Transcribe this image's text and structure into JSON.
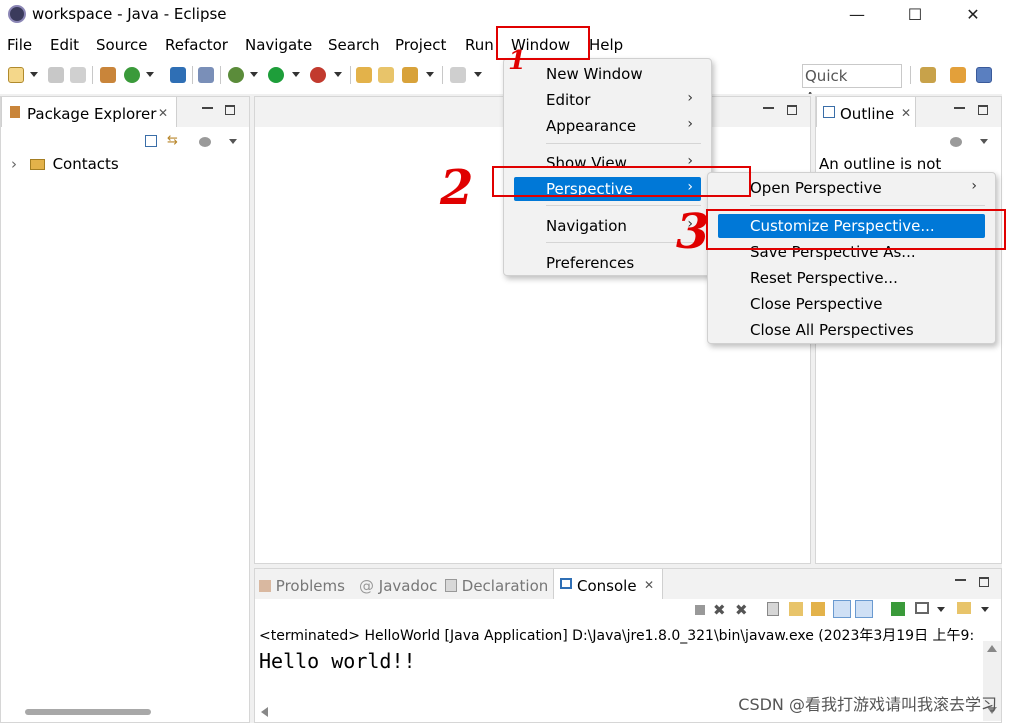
{
  "window": {
    "title": "workspace - Java - Eclipse",
    "minimize": "—",
    "maximize": "☐",
    "close": "✕"
  },
  "menubar": {
    "items": [
      "File",
      "Edit",
      "Source",
      "Refactor",
      "Navigate",
      "Search",
      "Project",
      "Run",
      "Window",
      "Help"
    ]
  },
  "toolbar": {
    "quick_access": "Quick Access"
  },
  "package_explorer": {
    "tab": "Package Explorer",
    "tree": [
      {
        "label": "Contacts",
        "expand": "›"
      }
    ]
  },
  "outline": {
    "tab": "Outline",
    "message": "An outline is not"
  },
  "bottom_tabs": [
    "Problems",
    "Javadoc",
    "Declaration",
    "Console"
  ],
  "console": {
    "status": "<terminated> HelloWorld [Java Application] D:\\Java\\jre1.8.0_321\\bin\\javaw.exe (2023年3月19日 上午9:",
    "output": "Hello world!!"
  },
  "window_menu": {
    "items": [
      {
        "label": "New Window",
        "submenu": false
      },
      {
        "label": "Editor",
        "submenu": true
      },
      {
        "label": "Appearance",
        "submenu": true
      },
      {
        "label": "Show View",
        "submenu": true
      },
      {
        "label": "Perspective",
        "submenu": true,
        "highlighted": true
      },
      {
        "label": "Navigation",
        "submenu": true
      },
      {
        "label": "Preferences",
        "submenu": false
      }
    ]
  },
  "perspective_menu": {
    "items": [
      {
        "label": "Open Perspective",
        "submenu": true
      },
      {
        "label": "Customize Perspective...",
        "highlighted": true
      },
      {
        "label": "Save Perspective As..."
      },
      {
        "label": "Reset Perspective..."
      },
      {
        "label": "Close Perspective"
      },
      {
        "label": "Close All Perspectives"
      }
    ]
  },
  "annotations": [
    "1",
    "2",
    "3"
  ],
  "watermark": "CSDN @看我打游戏请叫我滚去学习",
  "colors": {
    "highlight": "#0078d7",
    "annotation_red": "#e00000"
  }
}
